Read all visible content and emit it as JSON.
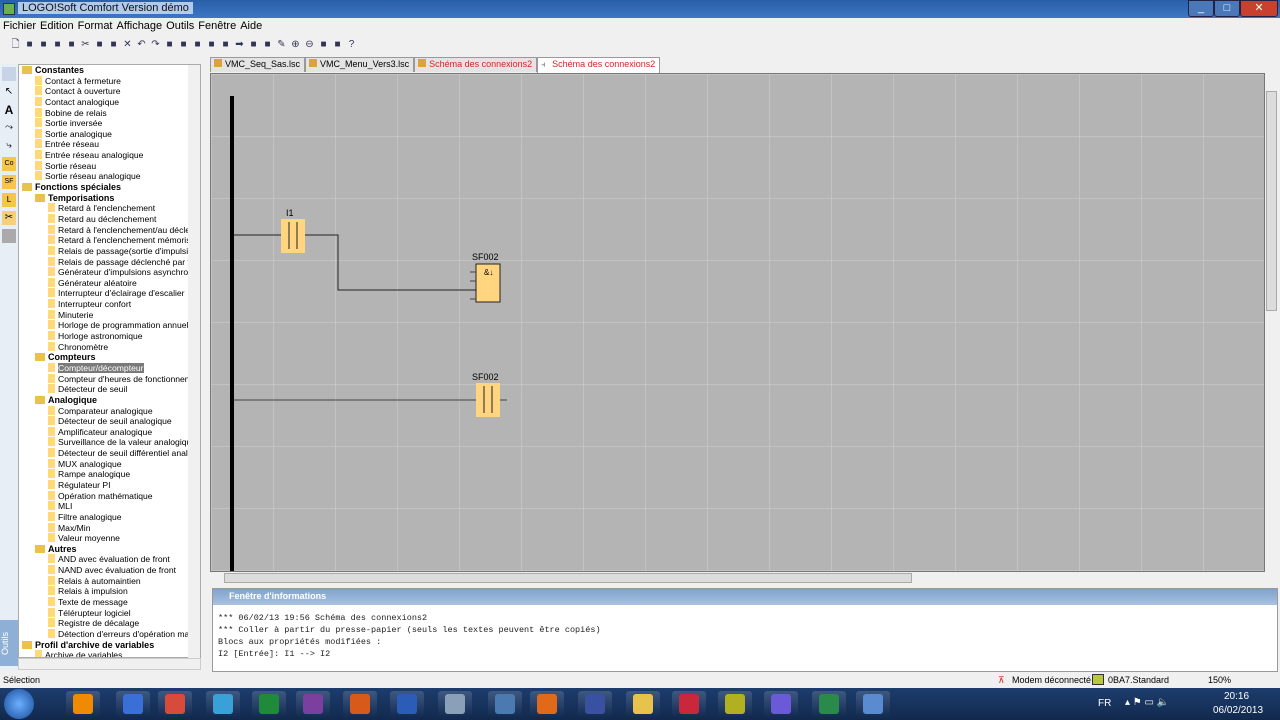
{
  "window": {
    "title": "LOGO!Soft Comfort Version démo",
    "controls": [
      "_",
      "□",
      "✕"
    ]
  },
  "menu": [
    "Fichier",
    "Edition",
    "Format",
    "Affichage",
    "Outils",
    "Fenêtre",
    "Aide"
  ],
  "toolbar_icons": [
    "new",
    "open",
    "open-red",
    "save",
    "print",
    "cut",
    "copy",
    "paste",
    "delete",
    "undo",
    "redo",
    "align-left",
    "align",
    "align-top",
    "align-h",
    "align-v",
    "forward",
    "block",
    "block2",
    "pencil",
    "zoom-in",
    "zoom-out",
    "fit",
    "simulation",
    "help"
  ],
  "left_tools": {
    "label": "Outils",
    "items": [
      "selection",
      "text",
      "connect",
      "split",
      "Co",
      "SF",
      "L",
      "cut-tool",
      "layer"
    ]
  },
  "tree": [
    {
      "label": "Constantes",
      "level": 0,
      "group": true
    },
    {
      "label": "Contact à fermeture",
      "level": 1
    },
    {
      "label": "Contact à ouverture",
      "level": 1
    },
    {
      "label": "Contact analogique",
      "level": 1
    },
    {
      "label": "Bobine de relais",
      "level": 1
    },
    {
      "label": "Sortie inversée",
      "level": 1
    },
    {
      "label": "Sortie analogique",
      "level": 1
    },
    {
      "label": "Entrée réseau",
      "level": 1
    },
    {
      "label": "Entrée réseau analogique",
      "level": 1
    },
    {
      "label": "Sortie réseau",
      "level": 1
    },
    {
      "label": "Sortie réseau analogique",
      "level": 1
    },
    {
      "label": "Fonctions spéciales",
      "level": 0,
      "group": true
    },
    {
      "label": "Temporisations",
      "level": 1,
      "group": true
    },
    {
      "label": "Retard à l'enclenchement",
      "level": 2
    },
    {
      "label": "Retard au déclenchement",
      "level": 2
    },
    {
      "label": "Retard à l'enclenchement/au décle",
      "level": 2
    },
    {
      "label": "Retard à l'enclenchement mémoris",
      "level": 2
    },
    {
      "label": "Relais de passage(sortie d'impulsic",
      "level": 2
    },
    {
      "label": "Relais de passage déclenché par fr",
      "level": 2
    },
    {
      "label": "Générateur d'impulsions asynchron",
      "level": 2
    },
    {
      "label": "Générateur aléatoire",
      "level": 2
    },
    {
      "label": "Interrupteur d'éclairage d'escalier",
      "level": 2
    },
    {
      "label": "Interrupteur confort",
      "level": 2
    },
    {
      "label": "Minuterie",
      "level": 2
    },
    {
      "label": "Horloge de programmation annuell",
      "level": 2
    },
    {
      "label": "Horloge astronomique",
      "level": 2
    },
    {
      "label": "Chronomètre",
      "level": 2
    },
    {
      "label": "Compteurs",
      "level": 1,
      "group": true
    },
    {
      "label": "Compteur/décompteur",
      "level": 2,
      "selected": true
    },
    {
      "label": "Compteur d'heures de fonctionnem",
      "level": 2
    },
    {
      "label": "Détecteur de seuil",
      "level": 2
    },
    {
      "label": "Analogique",
      "level": 1,
      "group": true
    },
    {
      "label": "Comparateur analogique",
      "level": 2
    },
    {
      "label": "Détecteur de seuil analogique",
      "level": 2
    },
    {
      "label": "Amplificateur analogique",
      "level": 2
    },
    {
      "label": "Surveillance de la valeur analogiqu",
      "level": 2
    },
    {
      "label": "Détecteur de seuil différentiel analo",
      "level": 2
    },
    {
      "label": "MUX analogique",
      "level": 2
    },
    {
      "label": "Rampe analogique",
      "level": 2
    },
    {
      "label": "Régulateur PI",
      "level": 2
    },
    {
      "label": "Opération mathématique",
      "level": 2
    },
    {
      "label": "MLI",
      "level": 2
    },
    {
      "label": "Filtre analogique",
      "level": 2
    },
    {
      "label": "Max/Min",
      "level": 2
    },
    {
      "label": "Valeur moyenne",
      "level": 2
    },
    {
      "label": "Autres",
      "level": 1,
      "group": true
    },
    {
      "label": "AND avec évaluation de front",
      "level": 2
    },
    {
      "label": "NAND avec évaluation de front",
      "level": 2
    },
    {
      "label": "Relais à automaintien",
      "level": 2
    },
    {
      "label": "Relais à impulsion",
      "level": 2
    },
    {
      "label": "Texte de message",
      "level": 2
    },
    {
      "label": "Télérupteur logiciel",
      "level": 2
    },
    {
      "label": "Registre de décalage",
      "level": 2
    },
    {
      "label": "Détection d'erreurs d'opération ma",
      "level": 2
    },
    {
      "label": "Profil d'archive de variables",
      "level": 0,
      "group": true
    },
    {
      "label": "Archive de variables",
      "level": 1
    }
  ],
  "tabs": [
    {
      "label": "VMC_Seq_Sas.lsc",
      "red": false,
      "active": false
    },
    {
      "label": "VMC_Menu_Vers3.lsc",
      "red": false,
      "active": false
    },
    {
      "label": "Schéma des connexions2",
      "red": true,
      "active": false
    },
    {
      "label": "Schéma des connexions2",
      "red": true,
      "active": true
    }
  ],
  "diagram": {
    "contact1_label": "I1",
    "block_label": "SF002",
    "block_symbol": "&↓",
    "contact2_label": "SF002"
  },
  "info": {
    "title": "Fenêtre d'informations",
    "lines": [
      "*** 06/02/13 19:56 Schéma des connexions2",
      "*** Coller à partir du presse-papier (seuls les textes peuvent être copiés)",
      "Blocs aux propriétés modifiées :",
      "I2 [Entrée]: I1 --> I2"
    ]
  },
  "status": {
    "mode": "Sélection",
    "modem": "Modem déconnecté",
    "device": "0BA7.Standard",
    "zoom": "150%"
  },
  "taskbar": {
    "lang": "FR",
    "time": "20:16",
    "date": "06/02/2013",
    "apps": [
      {
        "name": "vlc",
        "color": "#f08a00"
      },
      {
        "name": "app2",
        "color": "#3a6fd8"
      },
      {
        "name": "app3",
        "color": "#d84a3a"
      },
      {
        "name": "app4",
        "color": "#3aa0d8"
      },
      {
        "name": "excel",
        "color": "#1f8a3a"
      },
      {
        "name": "onenote",
        "color": "#7b3fa0"
      },
      {
        "name": "powerpoint",
        "color": "#d85a1a"
      },
      {
        "name": "word",
        "color": "#2a5cb8"
      },
      {
        "name": "calculator",
        "color": "#8aa0b8"
      },
      {
        "name": "app10",
        "color": "#4a7ab0"
      },
      {
        "name": "firefox",
        "color": "#e06a1a"
      },
      {
        "name": "app12",
        "color": "#3a50a0"
      },
      {
        "name": "explorer",
        "color": "#e8c24a"
      },
      {
        "name": "app14",
        "color": "#c8283a"
      },
      {
        "name": "app15",
        "color": "#b0b020"
      },
      {
        "name": "app16",
        "color": "#6a5ad8"
      },
      {
        "name": "app17",
        "color": "#2a8a4a"
      },
      {
        "name": "logosoft",
        "color": "#5a8ad0"
      }
    ]
  }
}
